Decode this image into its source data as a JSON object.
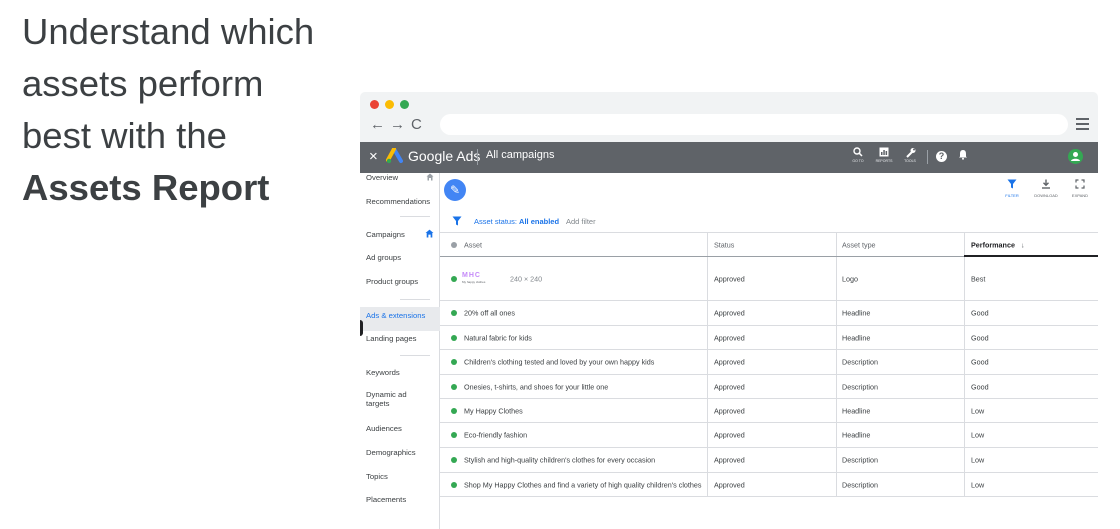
{
  "headline": {
    "line1": "Understand which",
    "line2": "assets perform",
    "line3": "best with the",
    "line4": "Assets Report"
  },
  "browser": {
    "dots": [
      "#ea4335",
      "#fbbc04",
      "#34a853"
    ],
    "back": "←",
    "forward": "→",
    "reload": "C"
  },
  "adsbar": {
    "close": "×",
    "brand": "Google Ads",
    "campaign": "All campaigns",
    "tools": [
      {
        "icon": "search-icon",
        "glyph": "🔍",
        "label": "GO TO"
      },
      {
        "icon": "reports-icon",
        "glyph": "▦",
        "label": "REPORTS"
      },
      {
        "icon": "wrench-icon",
        "glyph": "🔧",
        "label": "TOOLS"
      }
    ],
    "help": "?",
    "bell": "🔔",
    "account_initial": "●"
  },
  "sidebar": {
    "items": [
      {
        "label": "Overview"
      },
      {
        "label": "Recommendations"
      },
      {
        "label": "Campaigns"
      },
      {
        "label": "Ad groups"
      },
      {
        "label": "Product groups"
      },
      {
        "label": "Ads & extensions",
        "active": true
      },
      {
        "label": "Landing pages"
      },
      {
        "label": "Keywords"
      },
      {
        "label": "Dynamic ad targets"
      },
      {
        "label": "Audiences"
      },
      {
        "label": "Demographics"
      },
      {
        "label": "Topics"
      },
      {
        "label": "Placements"
      }
    ]
  },
  "toolbar": {
    "edit_glyph": "✎",
    "filter": {
      "glyph": "▼",
      "label": "FILTER"
    },
    "download": {
      "glyph": "⬇",
      "label": "DOWNLOAD"
    },
    "expand": {
      "glyph": "⛶",
      "label": "EXPAND"
    }
  },
  "filter": {
    "status_prefix": "Asset status:",
    "status_value": "All enabled",
    "add": "Add filter"
  },
  "table": {
    "headers": {
      "asset": "Asset",
      "status": "Status",
      "type": "Asset type",
      "performance": "Performance",
      "sort_arrow": "↓"
    },
    "logo": {
      "mark": "MHC",
      "caption": "My happy clothes",
      "dims": "240 × 240"
    },
    "rows": [
      {
        "asset": "",
        "status": "Approved",
        "type": "Logo",
        "performance": "Best"
      },
      {
        "asset": "20% off all ones",
        "status": "Approved",
        "type": "Headline",
        "performance": "Good"
      },
      {
        "asset": "Natural fabric for kids",
        "status": "Approved",
        "type": "Headline",
        "performance": "Good"
      },
      {
        "asset": "Children's clothing tested and loved by your own happy kids",
        "status": "Approved",
        "type": "Description",
        "performance": "Good"
      },
      {
        "asset": "Onesies, t-shirts, and shoes for your little one",
        "status": "Approved",
        "type": "Description",
        "performance": "Good"
      },
      {
        "asset": "My Happy Clothes",
        "status": "Approved",
        "type": "Headline",
        "performance": "Low"
      },
      {
        "asset": "Eco-friendly fashion",
        "status": "Approved",
        "type": "Headline",
        "performance": "Low"
      },
      {
        "asset": "Stylish and high-quality children's clothes for every occasion",
        "status": "Approved",
        "type": "Description",
        "performance": "Low"
      },
      {
        "asset": "Shop My Happy Clothes and find a variety of high quality children's clothes",
        "status": "Approved",
        "type": "Description",
        "performance": "Low"
      }
    ]
  }
}
